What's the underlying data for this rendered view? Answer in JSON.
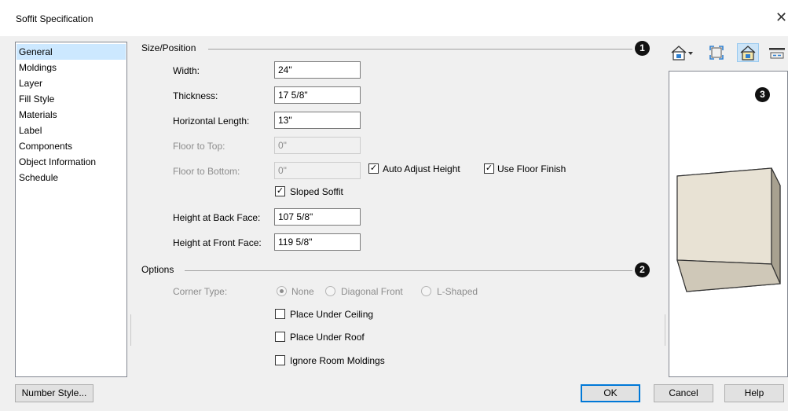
{
  "window": {
    "title": "Soffit Specification",
    "close_glyph": "✕"
  },
  "nav": {
    "items": [
      {
        "label": "General",
        "selected": true
      },
      {
        "label": "Moldings"
      },
      {
        "label": "Layer"
      },
      {
        "label": "Fill Style"
      },
      {
        "label": "Materials"
      },
      {
        "label": "Label"
      },
      {
        "label": "Components"
      },
      {
        "label": "Object Information"
      },
      {
        "label": "Schedule"
      }
    ]
  },
  "size_position": {
    "title": "Size/Position",
    "badge": "1",
    "width": {
      "label": "Width:",
      "value": "24\""
    },
    "thickness": {
      "label": "Thickness:",
      "value": "17 5/8\""
    },
    "horizontal_length": {
      "label": "Horizontal Length:",
      "value": "13\""
    },
    "floor_to_top": {
      "label": "Floor to Top:",
      "value": "0\""
    },
    "floor_to_bottom": {
      "label": "Floor to Bottom:",
      "value": "0\""
    },
    "auto_adjust_height": {
      "label": "Auto Adjust Height",
      "checked": true
    },
    "use_floor_finish": {
      "label": "Use Floor Finish",
      "checked": true
    },
    "sloped_soffit": {
      "label": "Sloped Soffit",
      "checked": true
    },
    "height_back": {
      "label": "Height at Back Face:",
      "value": "107 5/8\""
    },
    "height_front": {
      "label": "Height at Front Face:",
      "value": "119 5/8\""
    }
  },
  "options": {
    "title": "Options",
    "badge": "2",
    "corner_type": {
      "label": "Corner Type:",
      "choices": [
        "None",
        "Diagonal Front",
        "L-Shaped"
      ],
      "selected": "None"
    },
    "place_under_ceiling": {
      "label": "Place Under Ceiling",
      "checked": false
    },
    "place_under_roof": {
      "label": "Place Under Roof",
      "checked": false
    },
    "ignore_room_moldings": {
      "label": "Ignore Room Moldings",
      "checked": false
    }
  },
  "preview": {
    "badge": "3",
    "toolbar": [
      "camera-view-icon",
      "fill-window-icon",
      "color-toggle-icon",
      "fit-preview-icon"
    ]
  },
  "buttons": {
    "number_style": "Number Style...",
    "ok": "OK",
    "cancel": "Cancel",
    "help": "Help"
  },
  "check_glyph": "✓",
  "colors": {
    "accent": "#0078d7",
    "selection": "#cce8ff",
    "cube_face": "#e8e2d4",
    "cube_side": "#bdb6a6"
  }
}
